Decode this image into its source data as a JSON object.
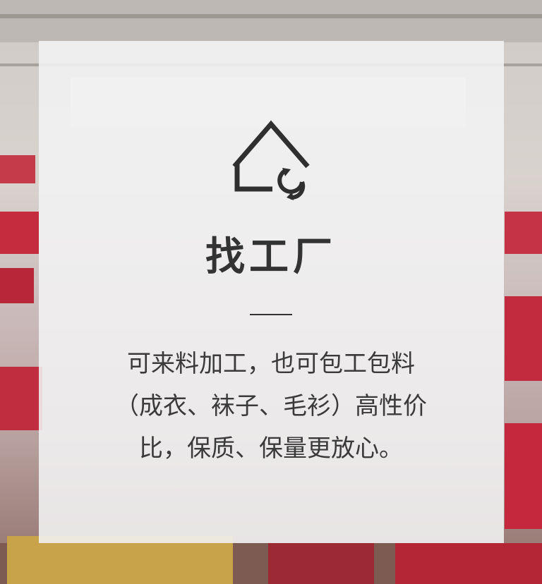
{
  "background": {
    "description_icon": "factory-photo-background",
    "accent_color": "#c8283a"
  },
  "card": {
    "icon": "house-refresh-icon",
    "title": "找工厂",
    "description_lines": [
      "可来料加工，也可包工包料",
      "（成衣、袜子、毛衫）高性价",
      "比，保质、保量更放心。"
    ]
  }
}
